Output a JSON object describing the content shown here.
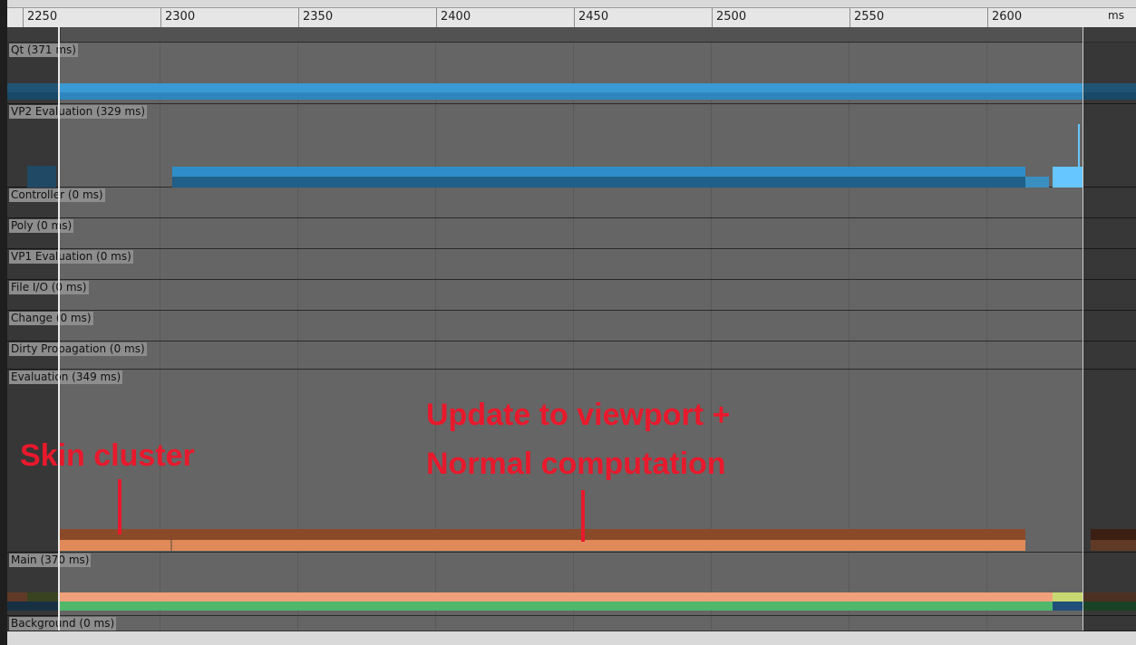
{
  "timeline": {
    "unit": "ms",
    "ticks": [
      "2250",
      "2300",
      "2350",
      "2400",
      "2450",
      "2500",
      "2550",
      "2600"
    ]
  },
  "tracks": [
    {
      "key": "qt",
      "label": "Qt (371 ms)"
    },
    {
      "key": "vp2",
      "label": "VP2 Evaluation (329 ms)"
    },
    {
      "key": "controller",
      "label": "Controller (0 ms)"
    },
    {
      "key": "poly",
      "label": "Poly (0 ms)"
    },
    {
      "key": "vp1",
      "label": "VP1 Evaluation (0 ms)"
    },
    {
      "key": "fileio",
      "label": "File I/O (0 ms)"
    },
    {
      "key": "change",
      "label": "Change (0 ms)"
    },
    {
      "key": "dirty",
      "label": "Dirty Propagation (0 ms)"
    },
    {
      "key": "evaluation",
      "label": "Evaluation (349 ms)"
    },
    {
      "key": "main",
      "label": "Main (370 ms)"
    },
    {
      "key": "background",
      "label": "Background (0 ms)"
    }
  ],
  "annotations": {
    "skin_cluster": "Skin cluster",
    "viewport_line1": "Update to viewport +",
    "viewport_line2": "Normal computation"
  },
  "colors": {
    "qt_bar": "#3a9ad6",
    "vp2_bar": "#2b7fb5",
    "vp2_highlight": "#66c6ff",
    "eval_dark": "#8a4a2a",
    "eval_light": "#e08a5a",
    "main_bar": "#f0a07a",
    "main_green": "#4fb86a",
    "annotation": "#e8192c"
  }
}
